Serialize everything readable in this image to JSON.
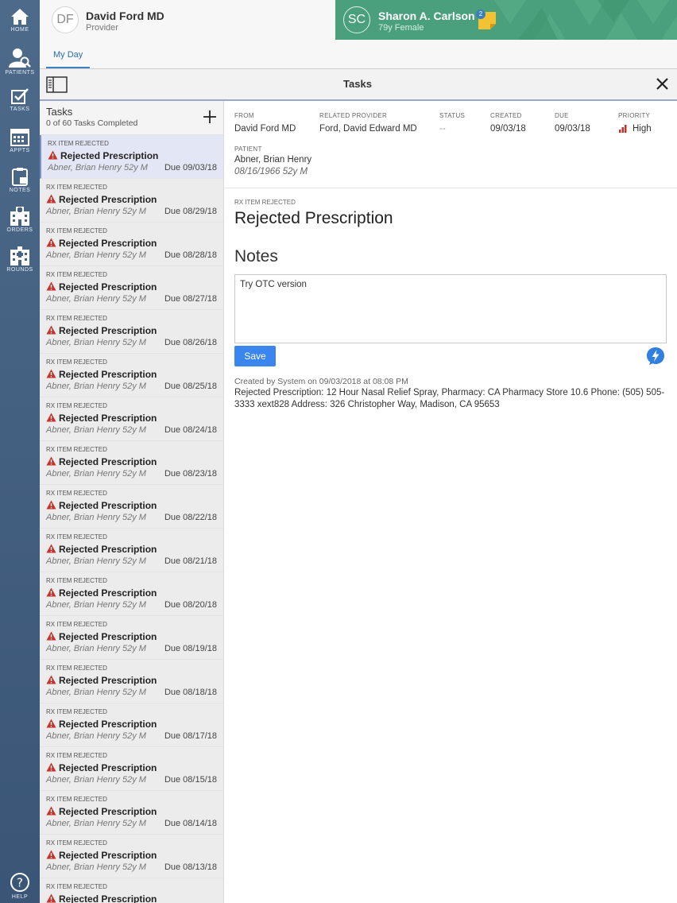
{
  "nav": {
    "items": [
      {
        "label": "HOME",
        "icon": "home-icon"
      },
      {
        "label": "PATIENTS",
        "icon": "patients-icon"
      },
      {
        "label": "TASKS",
        "icon": "tasks-icon"
      },
      {
        "label": "APPTS",
        "icon": "calendar-icon"
      },
      {
        "label": "NOTES",
        "icon": "notes-icon"
      },
      {
        "label": "ORDERS",
        "icon": "orders-icon"
      },
      {
        "label": "ROUNDS",
        "icon": "rounds-icon"
      }
    ],
    "help": {
      "label": "HELP",
      "icon": "help-icon"
    }
  },
  "provider": {
    "initials": "DF",
    "name": "David Ford MD",
    "role": "Provider"
  },
  "patient": {
    "initials": "SC",
    "name": "Sharon A. Carlson",
    "info": "79y Female",
    "note_count": "2"
  },
  "tabs": {
    "my_day": "My Day"
  },
  "panel": {
    "title": "Tasks"
  },
  "tasklist": {
    "title": "Tasks",
    "subtitle": "0 of 60 Tasks Completed",
    "tasks": [
      {
        "type": "RX ITEM REJECTED",
        "title": "Rejected Prescription",
        "patient": "Abner, Brian Henry 52y M",
        "due": "Due 09/03/18"
      },
      {
        "type": "RX ITEM REJECTED",
        "title": "Rejected Prescription",
        "patient": "Abner, Brian Henry 52y M",
        "due": "Due 08/29/18"
      },
      {
        "type": "RX ITEM REJECTED",
        "title": "Rejected Prescription",
        "patient": "Abner, Brian Henry 52y M",
        "due": "Due 08/28/18"
      },
      {
        "type": "RX ITEM REJECTED",
        "title": "Rejected Prescription",
        "patient": "Abner, Brian Henry 52y M",
        "due": "Due 08/27/18"
      },
      {
        "type": "RX ITEM REJECTED",
        "title": "Rejected Prescription",
        "patient": "Abner, Brian Henry 52y M",
        "due": "Due 08/26/18"
      },
      {
        "type": "RX ITEM REJECTED",
        "title": "Rejected Prescription",
        "patient": "Abner, Brian Henry 52y M",
        "due": "Due 08/25/18"
      },
      {
        "type": "RX ITEM REJECTED",
        "title": "Rejected Prescription",
        "patient": "Abner, Brian Henry 52y M",
        "due": "Due 08/24/18"
      },
      {
        "type": "RX ITEM REJECTED",
        "title": "Rejected Prescription",
        "patient": "Abner, Brian Henry 52y M",
        "due": "Due 08/23/18"
      },
      {
        "type": "RX ITEM REJECTED",
        "title": "Rejected Prescription",
        "patient": "Abner, Brian Henry 52y M",
        "due": "Due 08/22/18"
      },
      {
        "type": "RX ITEM REJECTED",
        "title": "Rejected Prescription",
        "patient": "Abner, Brian Henry 52y M",
        "due": "Due 08/21/18"
      },
      {
        "type": "RX ITEM REJECTED",
        "title": "Rejected Prescription",
        "patient": "Abner, Brian Henry 52y M",
        "due": "Due 08/20/18"
      },
      {
        "type": "RX ITEM REJECTED",
        "title": "Rejected Prescription",
        "patient": "Abner, Brian Henry 52y M",
        "due": "Due 08/19/18"
      },
      {
        "type": "RX ITEM REJECTED",
        "title": "Rejected Prescription",
        "patient": "Abner, Brian Henry 52y M",
        "due": "Due 08/18/18"
      },
      {
        "type": "RX ITEM REJECTED",
        "title": "Rejected Prescription",
        "patient": "Abner, Brian Henry 52y M",
        "due": "Due 08/17/18"
      },
      {
        "type": "RX ITEM REJECTED",
        "title": "Rejected Prescription",
        "patient": "Abner, Brian Henry 52y M",
        "due": "Due 08/15/18"
      },
      {
        "type": "RX ITEM REJECTED",
        "title": "Rejected Prescription",
        "patient": "Abner, Brian Henry 52y M",
        "due": "Due 08/14/18"
      },
      {
        "type": "RX ITEM REJECTED",
        "title": "Rejected Prescription",
        "patient": "Abner, Brian Henry 52y M",
        "due": "Due 08/13/18"
      },
      {
        "type": "RX ITEM REJECTED",
        "title": "Rejected Prescription",
        "patient": "",
        "due": ""
      }
    ]
  },
  "detail": {
    "from_label": "FROM",
    "from": "David Ford MD",
    "related_label": "RELATED PROVIDER",
    "related": "Ford, David Edward MD",
    "status_label": "STATUS",
    "status": "--",
    "created_label": "CREATED",
    "created": "09/03/18",
    "due_label": "DUE",
    "due": "09/03/18",
    "priority_label": "PRIORITY",
    "priority": "High",
    "patient_label": "PATIENT",
    "patient_name": "Abner, Brian Henry",
    "patient_dob": "08/16/1966 52y M",
    "type": "RX ITEM REJECTED",
    "title": "Rejected Prescription",
    "notes_heading": "Notes",
    "notes_text": "Try OTC version",
    "save_label": "Save",
    "created_by": "Created by System on 09/03/2018 at 08:08 PM",
    "description": "Rejected Prescription: 12 Hour Nasal Relief Spray, Pharmacy: CA Pharmacy Store 10.6 Phone: (505) 505-3333 xext828 Address: 326 Christopher Way, Madison, CA 95653"
  },
  "colors": {
    "rail": "#466284",
    "patient_header": "#4aa07c",
    "accent_blue": "#3b86ee",
    "selected_row": "#e3e6f4",
    "warning_red": "#c8312a"
  }
}
